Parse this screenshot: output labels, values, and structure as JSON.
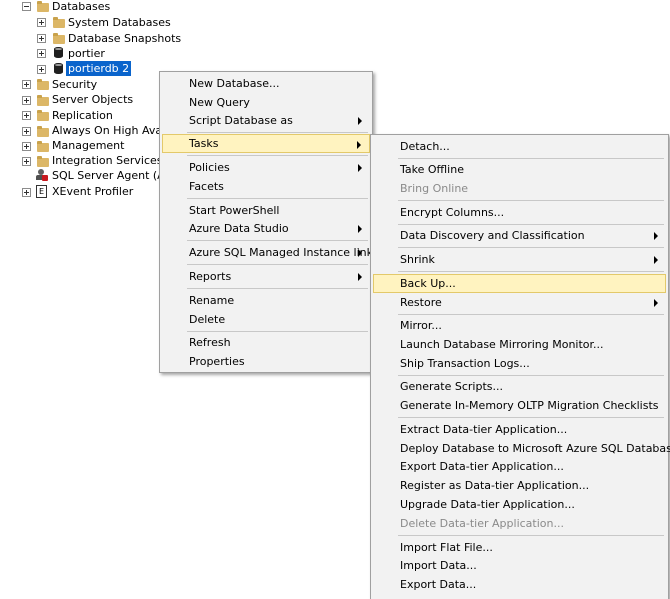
{
  "tree": {
    "databases": "Databases",
    "system_databases": "System Databases",
    "database_snapshots": "Database Snapshots",
    "portier": "portier",
    "portierdb2": "portierdb 2",
    "security": "Security",
    "server_objects": "Server Objects",
    "replication": "Replication",
    "always_on": "Always On High Availab",
    "management": "Management",
    "integration_services": "Integration Services Cata",
    "sql_server_agent": "SQL Server Agent (Agen",
    "xevent_profiler": "XEvent Profiler"
  },
  "context_menu": {
    "new_database": "New Database...",
    "new_query": "New Query",
    "script_database_as": "Script Database as",
    "tasks": "Tasks",
    "policies": "Policies",
    "facets": "Facets",
    "start_powershell": "Start PowerShell",
    "azure_data_studio": "Azure Data Studio",
    "azure_sql_mi_link": "Azure SQL Managed Instance link",
    "reports": "Reports",
    "rename": "Rename",
    "delete": "Delete",
    "refresh": "Refresh",
    "properties": "Properties"
  },
  "tasks_menu": {
    "detach": "Detach...",
    "take_offline": "Take Offline",
    "bring_online": "Bring Online",
    "encrypt_columns": "Encrypt Columns...",
    "data_discovery": "Data Discovery and Classification",
    "shrink": "Shrink",
    "back_up": "Back Up...",
    "restore": "Restore",
    "mirror": "Mirror...",
    "launch_mirroring_monitor": "Launch Database Mirroring Monitor...",
    "ship_transaction_logs": "Ship Transaction Logs...",
    "generate_scripts": "Generate Scripts...",
    "generate_inmemory": "Generate In-Memory OLTP Migration Checklists",
    "extract_data_tier": "Extract Data-tier Application...",
    "deploy_to_azure": "Deploy Database to Microsoft Azure SQL Database...",
    "export_data_tier": "Export Data-tier Application...",
    "register_data_tier": "Register as Data-tier Application...",
    "upgrade_data_tier": "Upgrade Data-tier Application...",
    "delete_data_tier": "Delete Data-tier Application...",
    "import_flat_file": "Import Flat File...",
    "import_data": "Import Data...",
    "export_data": "Export Data..."
  },
  "colors": {
    "selection": "#0a64cc",
    "menu_background": "#f2f2f2",
    "hover_background": "#fff3c0",
    "hover_border": "#e3c96a",
    "folder": "#dcb767"
  }
}
